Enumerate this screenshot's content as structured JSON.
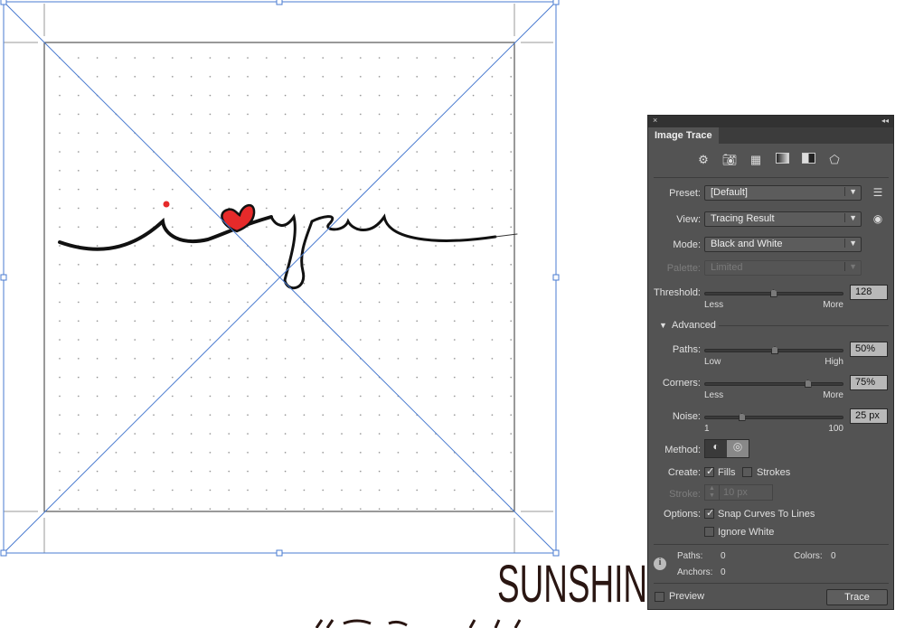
{
  "canvas": {
    "artwork_text": "i love you",
    "sunshine_text": "SUNSHIN",
    "heart_color": "#e62a2a",
    "guide_color": "#4a7bd0"
  },
  "panel": {
    "title": "Image Trace",
    "close_icon": "×",
    "collapse_icon": "◂◂",
    "presets_icons": [
      "auto-color-icon",
      "high-color-icon",
      "low-color-icon",
      "grayscale-icon",
      "black-white-icon",
      "outline-icon"
    ],
    "preset": {
      "label": "Preset:",
      "value": "[Default]"
    },
    "view": {
      "label": "View:",
      "value": "Tracing Result"
    },
    "mode": {
      "label": "Mode:",
      "value": "Black and White"
    },
    "palette": {
      "label": "Palette:",
      "value": "Limited"
    },
    "threshold": {
      "label": "Threshold:",
      "value": "128",
      "min_label": "Less",
      "max_label": "More",
      "fraction": 0.49
    },
    "advanced_label": "Advanced",
    "paths": {
      "label": "Paths:",
      "value": "50%",
      "min_label": "Low",
      "max_label": "High",
      "fraction": 0.5
    },
    "corners": {
      "label": "Corners:",
      "value": "75%",
      "min_label": "Less",
      "max_label": "More",
      "fraction": 0.75
    },
    "noise": {
      "label": "Noise:",
      "value": "25 px",
      "min_label": "1",
      "max_label": "100",
      "fraction": 0.25
    },
    "method_label": "Method:",
    "create": {
      "label": "Create:",
      "fills": "Fills",
      "strokes": "Strokes",
      "fills_checked": true,
      "strokes_checked": false
    },
    "stroke": {
      "label": "Stroke:",
      "value": "10 px"
    },
    "options": {
      "label": "Options:",
      "snap": "Snap Curves To Lines",
      "ignore_white": "Ignore White",
      "snap_checked": true,
      "ignore_checked": false
    },
    "info": {
      "paths_label": "Paths:",
      "paths_value": "0",
      "colors_label": "Colors:",
      "colors_value": "0",
      "anchors_label": "Anchors:",
      "anchors_value": "0"
    },
    "preview_label": "Preview",
    "trace_label": "Trace"
  }
}
